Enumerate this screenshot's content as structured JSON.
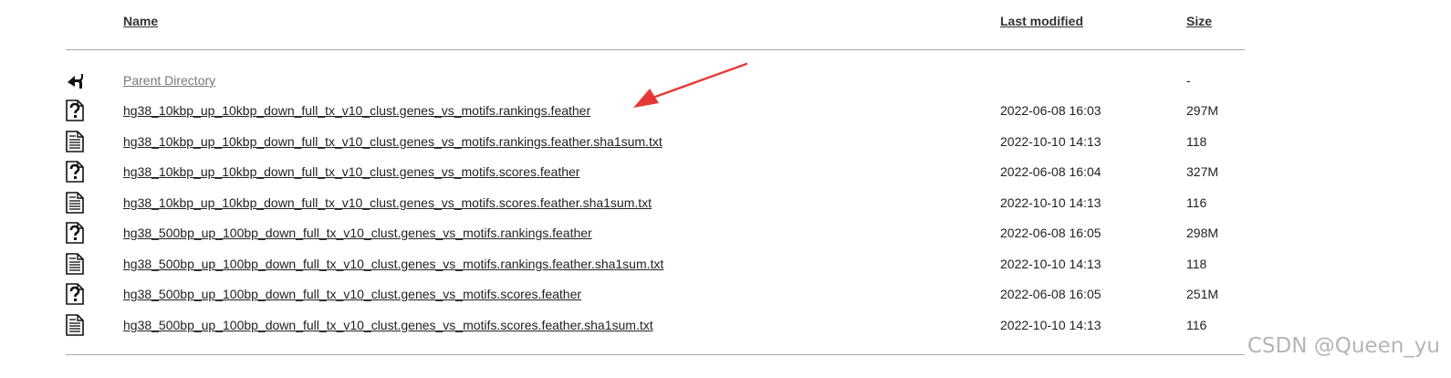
{
  "header": {
    "name": "Name",
    "last_modified": "Last modified",
    "size": "Size"
  },
  "parent": {
    "name": "Parent Directory",
    "date": "",
    "size": "-",
    "icon": "back-arrow-icon"
  },
  "rows": [
    {
      "name": "hg38_10kbp_up_10kbp_down_full_tx_v10_clust.genes_vs_motifs.rankings.feather",
      "date": "2022-06-08 16:03",
      "size": "297M",
      "icon": "unknown-file-icon"
    },
    {
      "name": "hg38_10kbp_up_10kbp_down_full_tx_v10_clust.genes_vs_motifs.rankings.feather.sha1sum.txt",
      "date": "2022-10-10 14:13",
      "size": "118",
      "icon": "text-file-icon"
    },
    {
      "name": "hg38_10kbp_up_10kbp_down_full_tx_v10_clust.genes_vs_motifs.scores.feather",
      "date": "2022-06-08 16:04",
      "size": "327M",
      "icon": "unknown-file-icon"
    },
    {
      "name": "hg38_10kbp_up_10kbp_down_full_tx_v10_clust.genes_vs_motifs.scores.feather.sha1sum.txt",
      "date": "2022-10-10 14:13",
      "size": "116",
      "icon": "text-file-icon"
    },
    {
      "name": "hg38_500bp_up_100bp_down_full_tx_v10_clust.genes_vs_motifs.rankings.feather",
      "date": "2022-06-08 16:05",
      "size": "298M",
      "icon": "unknown-file-icon"
    },
    {
      "name": "hg38_500bp_up_100bp_down_full_tx_v10_clust.genes_vs_motifs.rankings.feather.sha1sum.txt",
      "date": "2022-10-10 14:13",
      "size": "118",
      "icon": "text-file-icon"
    },
    {
      "name": "hg38_500bp_up_100bp_down_full_tx_v10_clust.genes_vs_motifs.scores.feather",
      "date": "2022-06-08 16:05",
      "size": "251M",
      "icon": "unknown-file-icon"
    },
    {
      "name": "hg38_500bp_up_100bp_down_full_tx_v10_clust.genes_vs_motifs.scores.feather.sha1sum.txt",
      "date": "2022-10-10 14:13",
      "size": "116",
      "icon": "text-file-icon"
    }
  ],
  "annotation": {
    "arrow_color": "#e53935",
    "icon": "red-arrow-annotation-icon"
  },
  "watermark": "CSDN @Queen_yu"
}
